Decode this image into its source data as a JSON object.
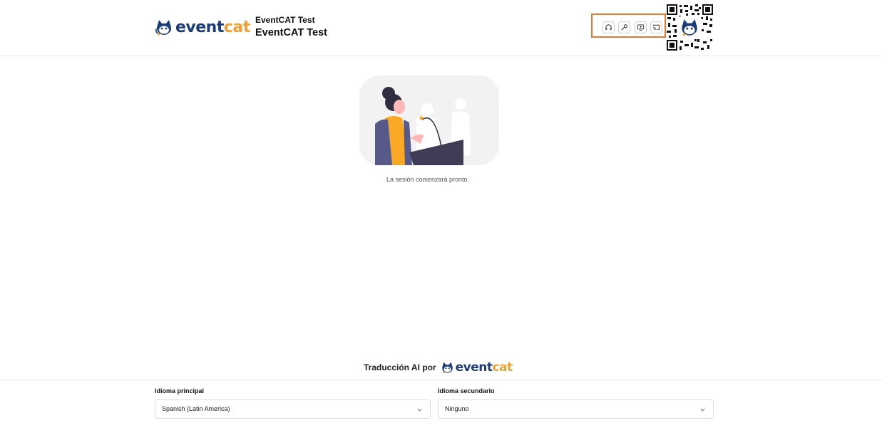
{
  "brand": {
    "name_part1": "event",
    "name_part2": "cat"
  },
  "header": {
    "event_subtitle": "EventCAT Test",
    "event_title": "EventCAT Test",
    "toolbar": [
      {
        "icon": "headphones-icon"
      },
      {
        "icon": "wrench-icon"
      },
      {
        "icon": "screen-share-icon"
      },
      {
        "icon": "cast-icon"
      }
    ]
  },
  "main": {
    "status_text": "La sesión comenzará pronto."
  },
  "footer": {
    "powered_by": "Traducción AI por",
    "primary_language": {
      "label": "Idioma principal",
      "value": "Spanish (Latin America)"
    },
    "secondary_language": {
      "label": "Idioma secundario",
      "value": "Ninguno"
    }
  },
  "colors": {
    "brand_blue": "#1d3d7a",
    "brand_orange": "#f0a030",
    "highlight": "#e8772e"
  }
}
